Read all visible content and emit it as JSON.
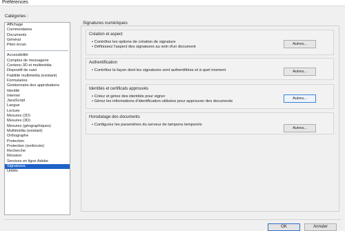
{
  "window": {
    "title": "Préférences"
  },
  "categories": {
    "label": "Catégories :",
    "group1": [
      "Affichage",
      "Commentaires",
      "Documents",
      "Général",
      "Plein écran"
    ],
    "group2": [
      "Accessibilité",
      "Comptes de messagerie",
      "Contenu 3D et multimédia",
      "Dispositif de suivi",
      "Fiabilité multimédia (existant)",
      "Formulaires",
      "Gestionnaire des approbations",
      "Identité",
      "Internet",
      "JavaScript",
      "Langue",
      "Lecture",
      "Mesures (2D)",
      "Mesures (3D)",
      "Mesures (géographiques)",
      "Multimédia (existant)",
      "Orthographe",
      "Protection",
      "Protection (renforcée)",
      "Recherche",
      "Révision",
      "Services en ligne Adobe",
      "Signatures",
      "Unités"
    ],
    "selected": "Signatures"
  },
  "signatures": {
    "title": "Signatures numériques",
    "sections": [
      {
        "title": "Création et aspect",
        "bullets": [
          "Contrôlez les options de création de signature",
          "Définissez l'aspect des signatures au sein d'un document"
        ],
        "button": "Autres..."
      },
      {
        "title": "Authentification",
        "bullets": [
          "Contrôlez la façon dont les signatures sont authentifiées et à quel moment"
        ],
        "button": "Autres..."
      },
      {
        "title": "Identités et certificats approuvés",
        "bullets": [
          "Créez et gérez des identités pour signer",
          "Gérez les informations d'identification utilisées pour approuver des documents"
        ],
        "button": "Autres..."
      },
      {
        "title": "Horodatage des documents",
        "bullets": [
          "Configurez les paramètres du serveur de tampons temporels"
        ],
        "button": "Autres..."
      }
    ]
  },
  "footer": {
    "ok": "OK",
    "cancel": "Annuler"
  }
}
